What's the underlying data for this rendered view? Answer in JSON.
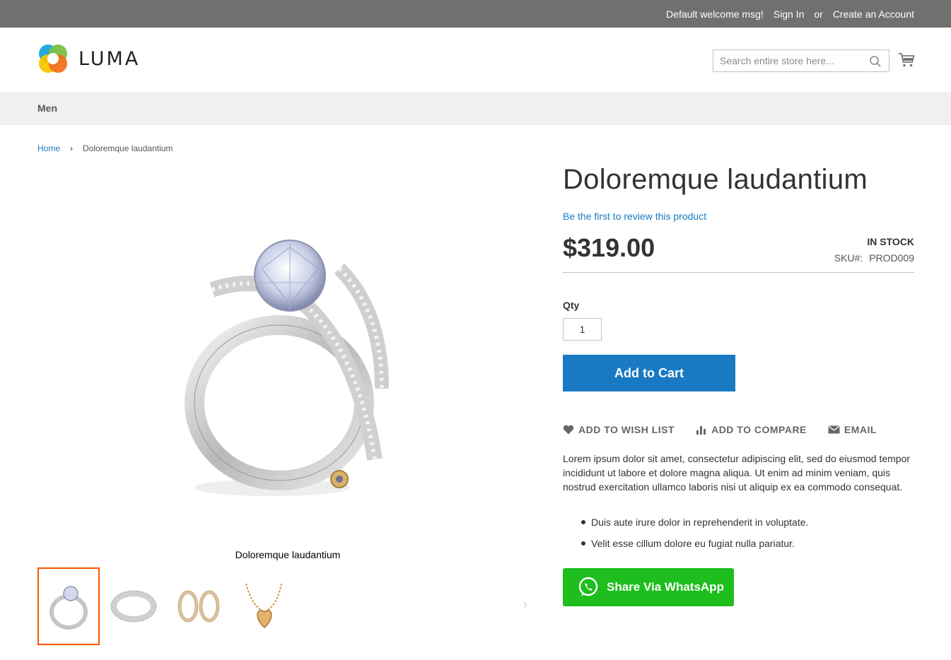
{
  "top_links": {
    "welcome": "Default welcome msg!",
    "sign_in": "Sign In",
    "or": "or",
    "create_account": "Create an Account"
  },
  "header": {
    "logo_text": "LUMA",
    "search_placeholder": "Search entire store here..."
  },
  "nav": {
    "items": [
      {
        "label": "Men"
      }
    ]
  },
  "breadcrumb": {
    "home": "Home",
    "separator": "›",
    "current": "Doloremque laudantium"
  },
  "gallery": {
    "caption": "Doloremque laudantium",
    "thumbnails": [
      "ring",
      "bracelet",
      "earrings",
      "necklace"
    ],
    "next": "›"
  },
  "product": {
    "title": "Doloremque laudantium",
    "review_link": "Be the first to review this product",
    "price": "$319.00",
    "stock": "IN STOCK",
    "sku_label": "SKU#:",
    "sku_value": "PROD009",
    "qty_label": "Qty",
    "qty_value": "1",
    "add_to_cart": "Add to Cart",
    "actions": {
      "wish_list": "ADD TO WISH LIST",
      "compare": "ADD TO COMPARE",
      "email": "EMAIL"
    },
    "description": "Lorem ipsum dolor sit amet, consectetur adipiscing elit, sed do eiusmod tempor incididunt ut labore et dolore magna aliqua. Ut enim ad minim veniam, quis nostrud exercitation ullamco laboris nisi ut aliquip ex ea commodo consequat.",
    "bullets": [
      "Duis aute irure dolor in reprehenderit in voluptate.",
      "Velit esse cillum dolore eu fugiat nulla pariatur."
    ],
    "whatsapp": "Share Via WhatsApp"
  },
  "colors": {
    "accent": "#1979c3",
    "whatsapp": "#1ebe1e",
    "thumb_active": "#ff5501"
  }
}
